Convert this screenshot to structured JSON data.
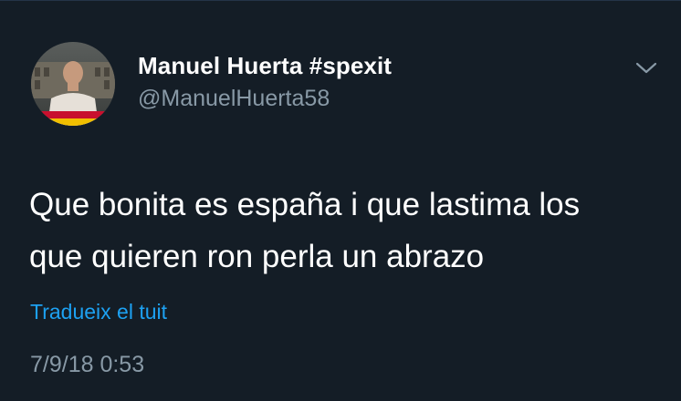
{
  "tweet": {
    "author": {
      "display_name": "Manuel Huerta #spexit",
      "handle": "@ManuelHuerta58"
    },
    "text_lines": [
      "Que bonita es españa i que lastima los",
      "que quieren ron perla un abrazo"
    ],
    "translate_label": "Tradueix el tuit",
    "timestamp": "7/9/18 0:53"
  },
  "icons": {
    "menu": "chevron-down-icon",
    "avatar": "avatar"
  },
  "colors": {
    "background": "#141d26",
    "primary_text": "#ffffff",
    "secondary_text": "#8899a6",
    "link": "#1da1f2"
  }
}
